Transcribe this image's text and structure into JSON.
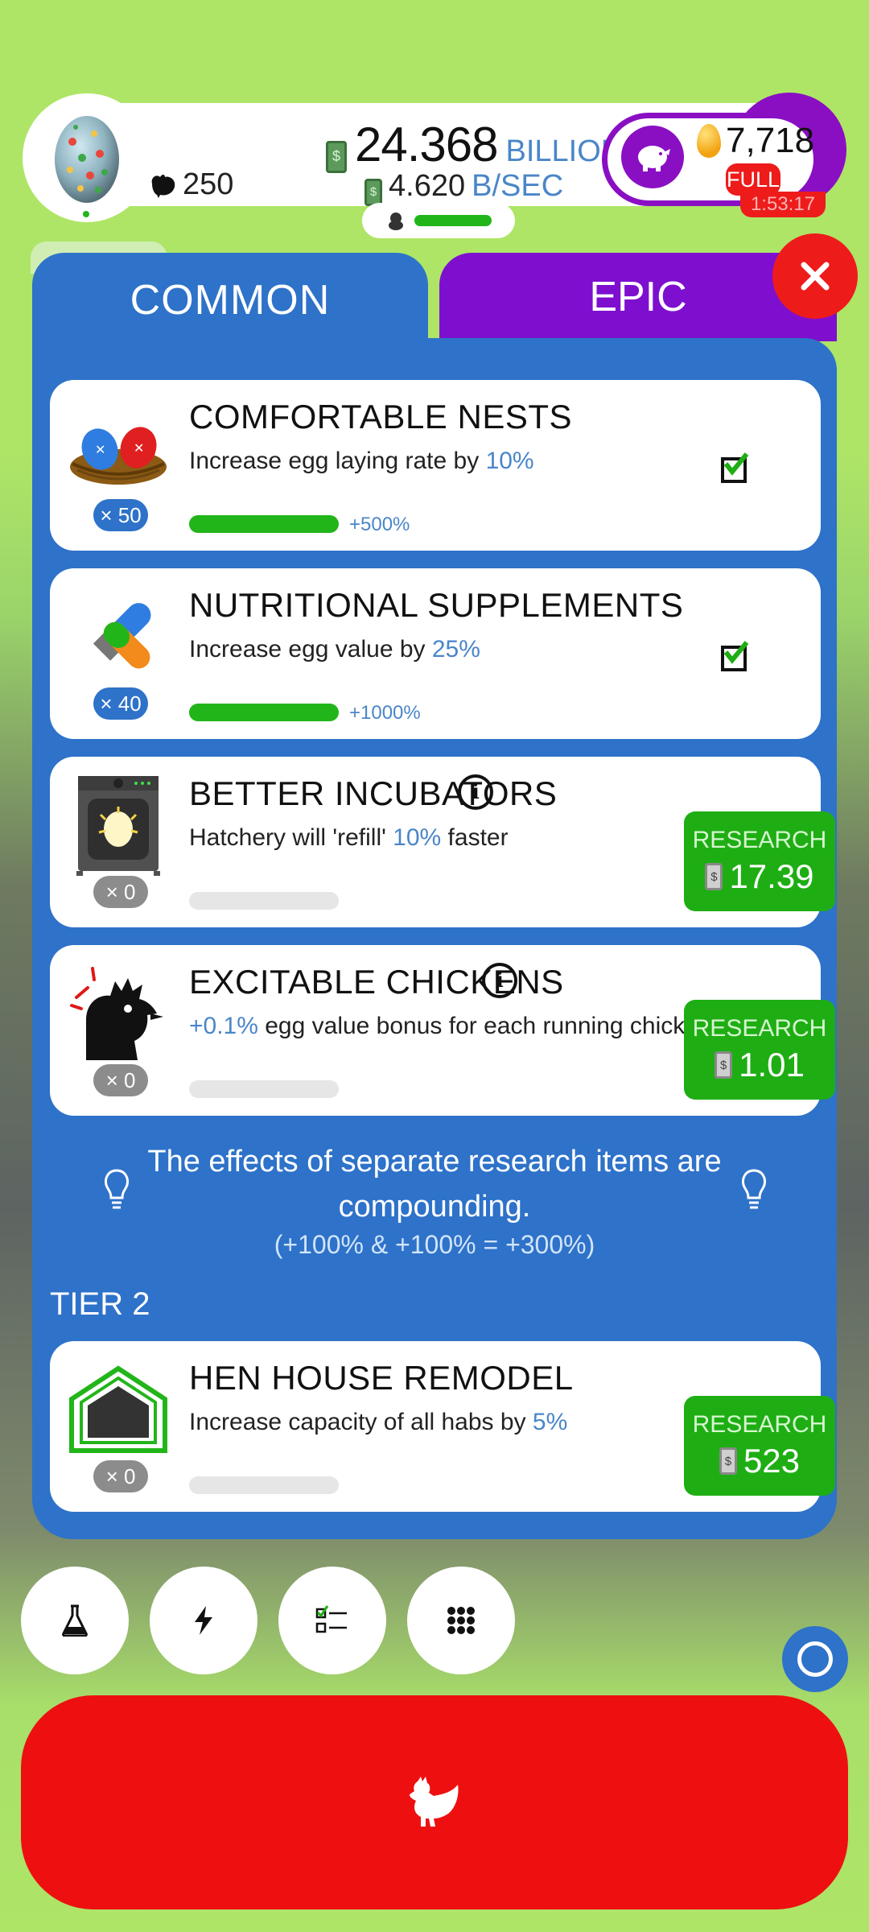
{
  "header": {
    "chicken_count": "250",
    "money_value": "24.368",
    "money_unit": "BILLION",
    "rate_value": "4.620",
    "rate_unit": "B/SEC",
    "golden_eggs": "7,718",
    "full_badge": "FULL",
    "timer": "1:53:17"
  },
  "tabs": {
    "common": "COMMON",
    "epic": "EPIC"
  },
  "research": {
    "tier1": [
      {
        "title": "COMFORTABLE NESTS",
        "desc_prefix": "Increase egg laying rate by ",
        "desc_highlight": "10%",
        "desc_suffix": "",
        "count": "× 50",
        "progress_fraction": 1.0,
        "progress_label": "+500%",
        "status": "completed"
      },
      {
        "title": "NUTRITIONAL SUPPLEMENTS",
        "desc_prefix": "Increase egg value by ",
        "desc_highlight": "25%",
        "desc_suffix": "",
        "count": "× 40",
        "progress_fraction": 1.0,
        "progress_label": "+1000%",
        "status": "completed"
      },
      {
        "title": "BETTER INCUBATORS",
        "desc_prefix": "Hatchery will 'refill' ",
        "desc_highlight": "10%",
        "desc_suffix": " faster",
        "count": "× 0",
        "progress_fraction": 0,
        "research_label": "RESEARCH",
        "cost": "17.39"
      },
      {
        "title": "EXCITABLE CHICKENS",
        "desc_prefix": "",
        "desc_highlight": "+0.1%",
        "desc_suffix": " egg value bonus for each running chicken",
        "count": "× 0",
        "progress_fraction": 0,
        "research_label": "RESEARCH",
        "cost": "1.01"
      }
    ],
    "tip_text": "The effects of separate research items are compounding.",
    "tip_formula": "(+100% & +100% = +300%)",
    "tier2_label": "TIER 2",
    "tier2": [
      {
        "title": "HEN HOUSE REMODEL",
        "desc_prefix": "Increase capacity of all habs by ",
        "desc_highlight": "5%",
        "desc_suffix": "",
        "count": "× 0",
        "progress_fraction": 0,
        "research_label": "RESEARCH",
        "cost": "523"
      }
    ]
  },
  "colors": {
    "panel_blue": "#2e72c9",
    "epic_purple": "#7e0fcf",
    "research_green": "#1eae14",
    "alert_red": "#ee1b1b",
    "background_green": "#aee567"
  },
  "bottom_nav": {
    "icons": [
      "flask-icon",
      "lightning-icon",
      "checklist-icon",
      "grid-icon"
    ],
    "main_button_icon": "chicken-icon"
  }
}
